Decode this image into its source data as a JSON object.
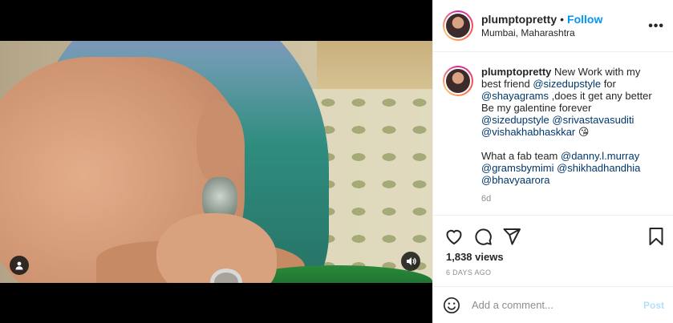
{
  "post": {
    "media": {
      "tag_icon": "user-tag-icon",
      "audio_icon": "speaker-icon"
    },
    "header": {
      "username": "plumptopretty",
      "separator": "•",
      "follow_label": "Follow",
      "location": "Mumbai, Maharashtra",
      "more_icon": "more-options-icon",
      "more_glyph": "•••"
    },
    "caption": {
      "username": "plumptopretty",
      "lines": [
        {
          "parts": [
            {
              "text": " New Work with my best friend "
            },
            {
              "text": "@sizedupstyle",
              "mention": true
            },
            {
              "text": " for "
            }
          ]
        },
        {
          "parts": [
            {
              "text": "@shayagrams",
              "mention": true
            },
            {
              "text": " ,does it get any better Be my galentine forever "
            }
          ]
        },
        {
          "parts": [
            {
              "text": "@sizedupstyle",
              "mention": true
            },
            {
              "text": " "
            },
            {
              "text": "@srivastavasuditi",
              "mention": true
            },
            {
              "text": " "
            },
            {
              "text": "@vishakhabhaskkar",
              "mention": true
            },
            {
              "text": " 😘"
            }
          ]
        }
      ],
      "second_paragraph": [
        {
          "text": "What a fab team "
        },
        {
          "text": "@danny.l.murray",
          "mention": true
        },
        {
          "text": " "
        },
        {
          "text": "@gramsbymimi",
          "mention": true
        },
        {
          "text": " "
        },
        {
          "text": "@shikhadhandhia",
          "mention": true
        },
        {
          "text": " "
        },
        {
          "text": "@bhavyaarora",
          "mention": true
        }
      ],
      "time_ago": "6d"
    },
    "actions": {
      "icons": [
        "heart-icon",
        "comment-icon",
        "share-icon",
        "bookmark-icon"
      ],
      "views": "1,838 views",
      "date": "6 DAYS AGO"
    },
    "comment_box": {
      "emoji_icon": "emoji-icon",
      "placeholder": "Add a comment...",
      "post_label": "Post"
    },
    "colors": {
      "link_blue": "#0095f6",
      "mention_blue": "#00376b",
      "post_disabled": "#b2dffc",
      "muted_gray": "#8e8e8e",
      "text": "#262626"
    }
  }
}
